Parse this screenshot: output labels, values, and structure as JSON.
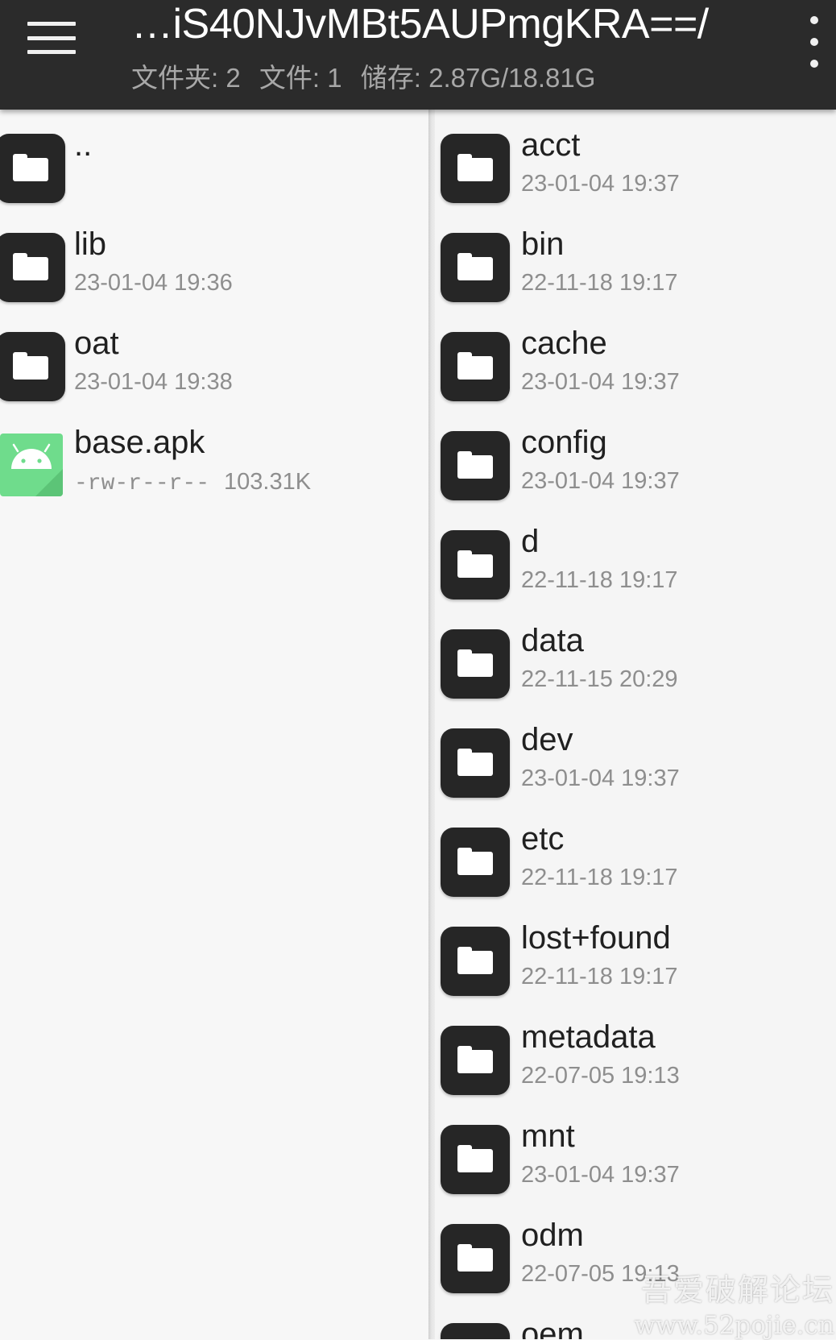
{
  "appbar": {
    "menu_icon": "hamburger-menu-icon",
    "title": "…iS40NJvMBt5AUPmgKRA==/",
    "stats": {
      "folders": "文件夹: 2",
      "files": "文件: 1",
      "storage": "储存: 2.87G/18.81G"
    },
    "more_icon": "more-vertical-icon"
  },
  "left_pane": {
    "items": [
      {
        "name": "..",
        "meta": "",
        "type": "folder"
      },
      {
        "name": "lib",
        "meta": "23-01-04 19:36",
        "type": "folder"
      },
      {
        "name": "oat",
        "meta": "23-01-04 19:38",
        "type": "folder"
      },
      {
        "name": "base.apk",
        "permissions": "-rw-r--r--",
        "size": "103.31K",
        "type": "apk"
      }
    ]
  },
  "right_pane": {
    "items": [
      {
        "name": "acct",
        "meta": "23-01-04 19:37"
      },
      {
        "name": "bin",
        "meta": "22-11-18 19:17"
      },
      {
        "name": "cache",
        "meta": "23-01-04 19:37"
      },
      {
        "name": "config",
        "meta": "23-01-04 19:37"
      },
      {
        "name": "d",
        "meta": "22-11-18 19:17"
      },
      {
        "name": "data",
        "meta": "22-11-15 20:29"
      },
      {
        "name": "dev",
        "meta": "23-01-04 19:37"
      },
      {
        "name": "etc",
        "meta": "22-11-18 19:17"
      },
      {
        "name": "lost+found",
        "meta": "22-11-18 19:17"
      },
      {
        "name": "metadata",
        "meta": "22-07-05 19:13"
      },
      {
        "name": "mnt",
        "meta": "23-01-04 19:37"
      },
      {
        "name": "odm",
        "meta": "22-07-05 19:13"
      },
      {
        "name": "oem",
        "meta": ""
      }
    ]
  },
  "watermark": {
    "line1": "吾爱破解论坛",
    "line2": "www.52pojie.cn"
  },
  "colors": {
    "appbar_bg": "#2b2b2b",
    "folder_icon_bg": "#262626",
    "apk_icon_bg": "#6fdc8c",
    "pane_bg": "#f7f7f7"
  }
}
